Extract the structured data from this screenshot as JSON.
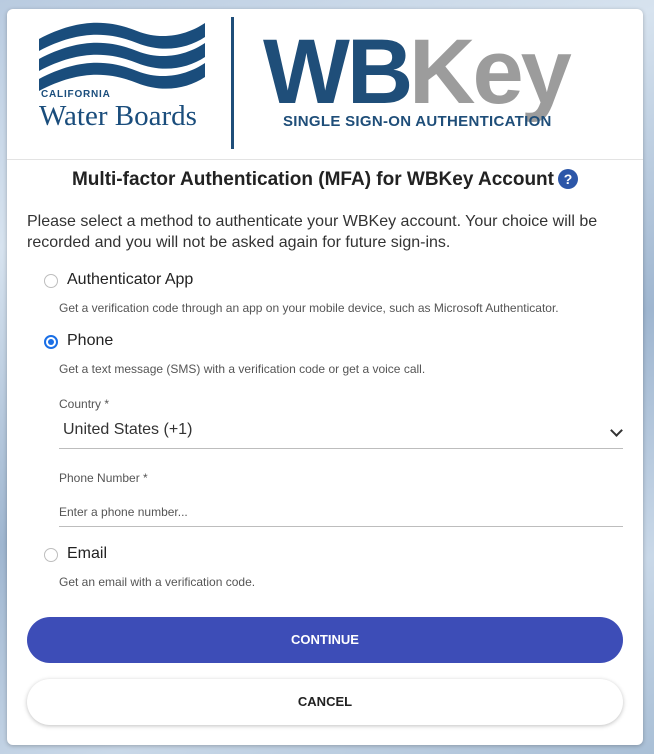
{
  "header": {
    "logo_small": "CALIFORNIA",
    "logo_big": "Water Boards",
    "brand_wb": "WB",
    "brand_key": "Key",
    "brand_sub": "SINGLE SIGN-ON AUTHENTICATION"
  },
  "title": "Multi-factor Authentication (MFA) for WBKey Account",
  "help_glyph": "?",
  "intro": "Please select a method to authenticate your WBKey account. Your choice will be recorded and you will not be asked again for future sign-ins.",
  "options": [
    {
      "label": "Authenticator App",
      "desc": "Get a verification code through an app on your mobile device, such as Microsoft Authenticator.",
      "selected": false
    },
    {
      "label": "Phone",
      "desc": "Get a text message (SMS) with a verification code or get a voice call.",
      "selected": true
    },
    {
      "label": "Email",
      "desc": "Get an email with a verification code.",
      "selected": false
    }
  ],
  "phone_form": {
    "country_label": "Country *",
    "country_value": "United States (+1)",
    "number_label": "Phone Number *",
    "number_placeholder": "Enter a phone number..."
  },
  "buttons": {
    "continue": "CONTINUE",
    "cancel": "CANCEL"
  },
  "colors": {
    "brand_navy": "#1f4e79",
    "brand_gray": "#9c9c9c",
    "primary_button": "#3d4db7",
    "radio_selected": "#1a6fe6"
  }
}
